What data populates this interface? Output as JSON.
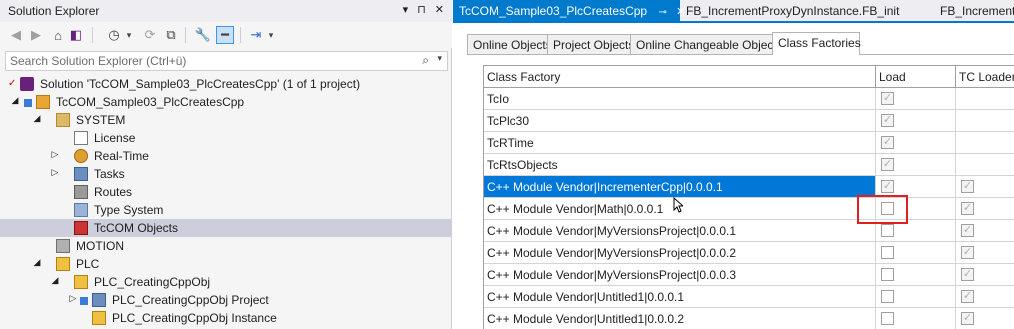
{
  "solution_explorer": {
    "title": "Solution Explorer",
    "title_buttons": [
      "▾",
      "⊓",
      "✕"
    ],
    "search_placeholder": "Search Solution Explorer (Ctrl+ü)",
    "tree": [
      {
        "label": "Solution 'TcCOM_Sample03_PlcCreatesCpp' (1 of 1 project)",
        "icon": "solution-icon",
        "expander": ""
      },
      {
        "label": "TcCOM_Sample03_PlcCreatesCpp",
        "icon": "twincat-project-icon",
        "expander": "◢"
      },
      {
        "label": "SYSTEM",
        "icon": "system-folder-icon",
        "expander": "◢"
      },
      {
        "label": "License",
        "icon": "license-icon",
        "expander": ""
      },
      {
        "label": "Real-Time",
        "icon": "realtime-icon",
        "expander": "▷"
      },
      {
        "label": "Tasks",
        "icon": "tasks-icon",
        "expander": "▷"
      },
      {
        "label": "Routes",
        "icon": "routes-icon",
        "expander": ""
      },
      {
        "label": "Type System",
        "icon": "type-system-icon",
        "expander": ""
      },
      {
        "label": "TcCOM Objects",
        "icon": "tccom-objects-icon",
        "expander": ""
      },
      {
        "label": "MOTION",
        "icon": "motion-icon",
        "expander": ""
      },
      {
        "label": "PLC",
        "icon": "plc-icon",
        "expander": "◢"
      },
      {
        "label": "PLC_CreatingCppObj",
        "icon": "plc-project-icon",
        "expander": "◢"
      },
      {
        "label": "PLC_CreatingCppObj Project",
        "icon": "plc-subproject-icon",
        "expander": "▷"
      },
      {
        "label": "PLC_CreatingCppObj Instance",
        "icon": "plc-instance-icon",
        "expander": ""
      }
    ]
  },
  "document_tabs": [
    {
      "label": "TcCOM_Sample03_PlcCreatesCpp",
      "active": true,
      "pin": "⊸",
      "close": "✕"
    },
    {
      "label": "FB_IncrementProxyDynInstance.FB_init",
      "active": false
    },
    {
      "label": "FB_IncrementP",
      "active": false
    }
  ],
  "sub_tabs": [
    "Online Objects",
    "Project Objects",
    "Online Changeable Objects",
    "Class Factories"
  ],
  "grid": {
    "columns": [
      "Class Factory",
      "Load",
      "TC Loader"
    ],
    "rows": [
      {
        "name": "TcIo",
        "load": true,
        "tc_loader": null
      },
      {
        "name": "TcPlc30",
        "load": true,
        "tc_loader": null
      },
      {
        "name": "TcRTime",
        "load": true,
        "tc_loader": null
      },
      {
        "name": "TcRtsObjects",
        "load": true,
        "tc_loader": null
      },
      {
        "name": "C++ Module Vendor|IncrementerCpp|0.0.0.1",
        "load": true,
        "tc_loader": true
      },
      {
        "name": "C++ Module Vendor|Math|0.0.0.1",
        "load": false,
        "tc_loader": true
      },
      {
        "name": "C++ Module Vendor|MyVersionsProject|0.0.0.1",
        "load": false,
        "tc_loader": true
      },
      {
        "name": "C++ Module Vendor|MyVersionsProject|0.0.0.2",
        "load": false,
        "tc_loader": true
      },
      {
        "name": "C++ Module Vendor|MyVersionsProject|0.0.0.3",
        "load": false,
        "tc_loader": true
      },
      {
        "name": "C++ Module Vendor|Untitled1|0.0.0.1",
        "load": false,
        "tc_loader": true
      },
      {
        "name": "C++ Module Vendor|Untitled1|0.0.0.2",
        "load": false,
        "tc_loader": true
      }
    ]
  },
  "check_glyph": "✓",
  "colors": {
    "accent": "#007acc",
    "selection": "#0078d7",
    "highlight_box": "#e02020",
    "tree_selection": "#cccedb"
  }
}
